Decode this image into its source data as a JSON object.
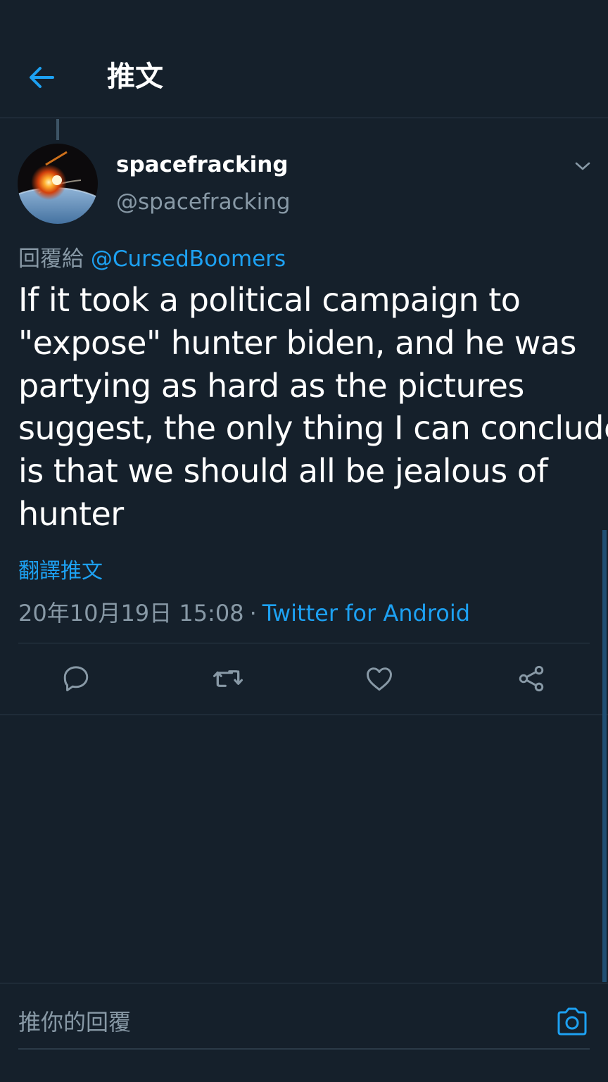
{
  "header": {
    "title": "推文"
  },
  "tweet": {
    "display_name": "spacefracking",
    "handle": "@spacefracking",
    "reply_prefix": "回覆給",
    "reply_to": "@CursedBoomers",
    "text_lines": [
      "If it took a political campaign to",
      "\"expose\" hunter biden, and he was",
      "partying as hard as the pictures",
      "suggest, the only thing I can conclude",
      "is that we should all be jealous of",
      "hunter"
    ],
    "translate_label": "翻譯推文",
    "timestamp": "20年10月19日 15:08",
    "separator": "·",
    "source": "Twitter for Android"
  },
  "actions": [
    {
      "icon": "reply-icon"
    },
    {
      "icon": "retweet-icon"
    },
    {
      "icon": "like-icon"
    },
    {
      "icon": "share-icon"
    }
  ],
  "reply_bar": {
    "placeholder": "推你的回覆"
  },
  "colors": {
    "background": "#15202b",
    "accent": "#1da1f2",
    "secondary_text": "#8899a6",
    "divider": "#2b3a48"
  }
}
